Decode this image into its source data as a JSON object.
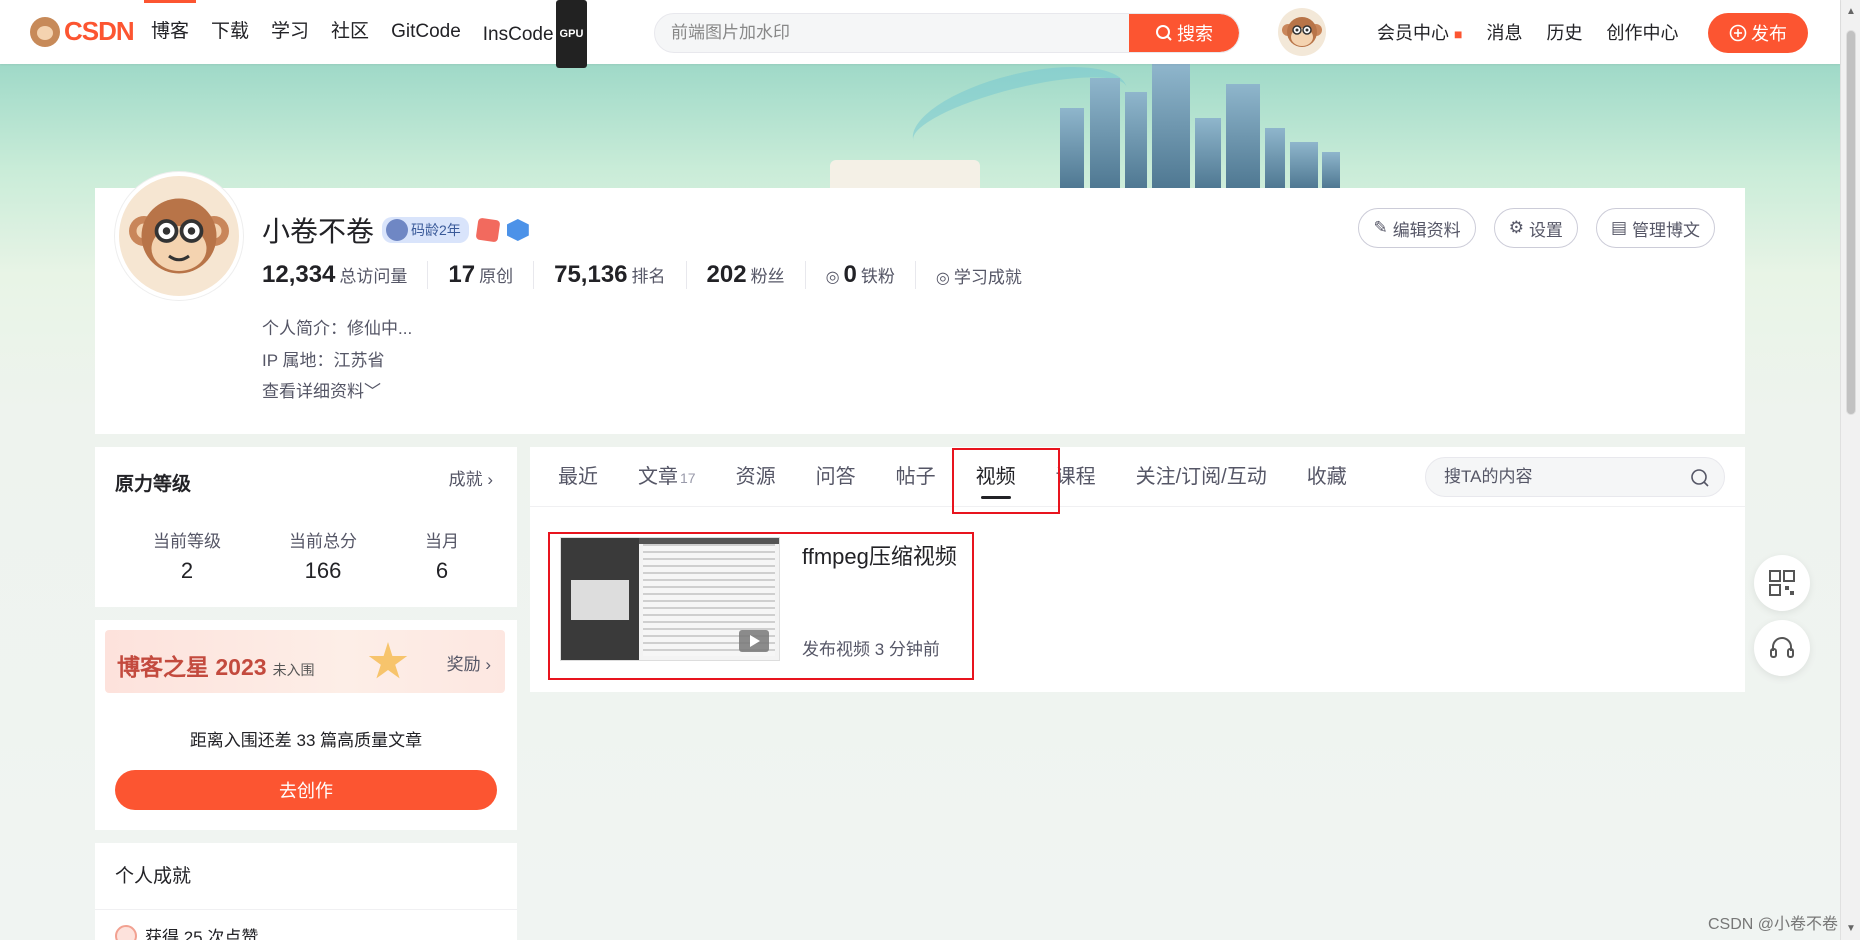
{
  "nav": {
    "logo_text": "CSDN",
    "items": [
      {
        "label": "博客",
        "active": true
      },
      {
        "label": "下载"
      },
      {
        "label": "学习"
      },
      {
        "label": "社区"
      },
      {
        "label": "GitCode"
      },
      {
        "label": "InsCode"
      }
    ],
    "gpu_badge": "GPU",
    "search_placeholder": "前端图片加水印",
    "search_button": "搜索",
    "right_items": [
      "会员中心",
      "消息",
      "历史",
      "创作中心"
    ],
    "publish_button": "发布",
    "accent": "#fc5531"
  },
  "profile": {
    "name": "小卷不卷",
    "code_age_badge": "码龄2年",
    "stats": [
      {
        "value": "12,334",
        "label": "总访问量"
      },
      {
        "value": "17",
        "label": "原创"
      },
      {
        "value": "75,136",
        "label": "排名"
      },
      {
        "value": "202",
        "label": "粉丝"
      },
      {
        "value": "0",
        "label": "铁粉"
      }
    ],
    "learning": "学习成就",
    "bio": "个人简介：修仙中...",
    "ip": "IP 属地：江苏省",
    "more": "查看详细资料",
    "buttons": [
      "编辑资料",
      "设置",
      "管理博文"
    ]
  },
  "level": {
    "title": "原力等级",
    "more": "成就",
    "cols": [
      {
        "label": "当前等级",
        "value": "2"
      },
      {
        "label": "当前总分",
        "value": "166"
      },
      {
        "label": "当月",
        "value": "6"
      }
    ]
  },
  "star": {
    "title": "博客之星 2023",
    "status": "未入围",
    "more": "奖励",
    "text": "距离入围还差 33 篇高质量文章",
    "button": "去创作"
  },
  "achievements": {
    "title": "个人成就",
    "first": "获得 25 次点赞"
  },
  "tabs": [
    {
      "label": "最近"
    },
    {
      "label": "文章",
      "count": "17"
    },
    {
      "label": "资源"
    },
    {
      "label": "问答"
    },
    {
      "label": "帖子"
    },
    {
      "label": "视频",
      "active": true
    },
    {
      "label": "课程"
    },
    {
      "label": "关注/订阅/互动"
    },
    {
      "label": "收藏"
    }
  ],
  "tab_search_placeholder": "搜TA的内容",
  "video": {
    "title": "ffmpeg压缩视频",
    "meta": "发布视频 3 分钟前"
  },
  "watermark": "CSDN @小卷不卷"
}
